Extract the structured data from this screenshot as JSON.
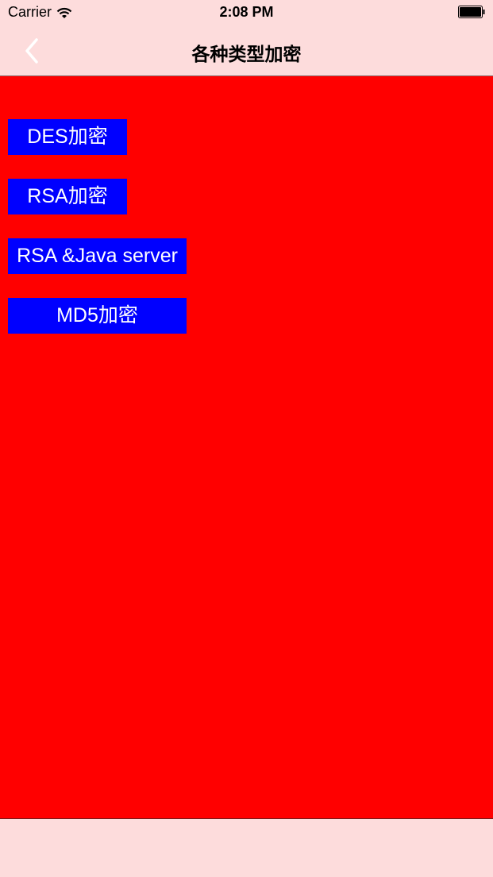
{
  "status_bar": {
    "carrier": "Carrier",
    "time": "2:08 PM",
    "wifi_icon": "wifi-icon",
    "battery_icon": "battery-icon"
  },
  "nav": {
    "title": "各种类型加密",
    "back_icon": "chevron-left-icon"
  },
  "buttons": [
    {
      "label": "DES加密"
    },
    {
      "label": "RSA加密"
    },
    {
      "label": "RSA &Java server"
    },
    {
      "label": "MD5加密"
    }
  ],
  "colors": {
    "bar_background": "#fddcdc",
    "content_background": "#ff0000",
    "button_background": "#0000ff",
    "button_text": "#ffffff"
  }
}
